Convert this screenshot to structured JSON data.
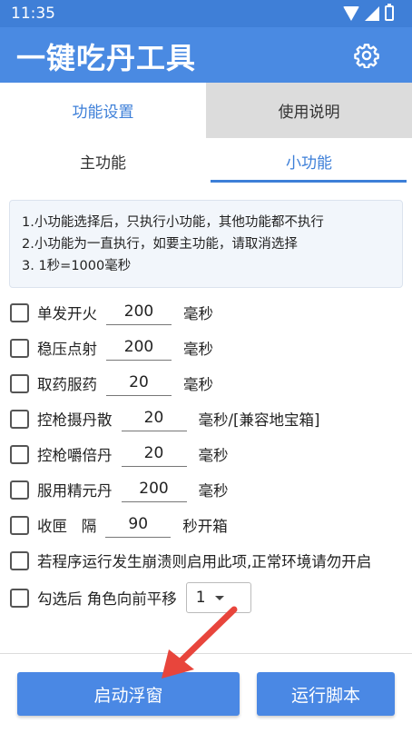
{
  "status_bar": {
    "time": "11:35"
  },
  "app": {
    "title": "一键吃丹工具",
    "settings_icon": "gear-icon"
  },
  "top_tabs": [
    {
      "label": "功能设置",
      "active": true
    },
    {
      "label": "使用说明",
      "active": false
    }
  ],
  "sub_tabs": [
    {
      "label": "主功能",
      "active": false
    },
    {
      "label": "小功能",
      "active": true
    }
  ],
  "info": {
    "lines": [
      "1.小功能选择后，只执行小功能，其他功能都不执行",
      "2.小功能为一直执行，如要主功能，请取消选择",
      "3. 1秒=1000毫秒"
    ]
  },
  "options": [
    {
      "label": "单发开火",
      "value": "200",
      "unit": "毫秒",
      "checked": false
    },
    {
      "label": "稳压点射",
      "value": "200",
      "unit": "毫秒",
      "checked": false
    },
    {
      "label": "取药服药",
      "value": "20",
      "unit": "毫秒",
      "checked": false
    },
    {
      "label": "控枪摄丹散",
      "value": "20",
      "unit": "毫秒/[兼容地宝箱]",
      "checked": false
    },
    {
      "label": "控枪嚼倍丹",
      "value": "20",
      "unit": "毫秒",
      "checked": false
    },
    {
      "label": "服用精元丹",
      "value": "200",
      "unit": "毫秒",
      "checked": false
    },
    {
      "label": "收匣   隔",
      "value": "90",
      "unit": "秒开箱",
      "checked": false
    },
    {
      "label": "若程序运行发生崩溃则启用此项,正常环境请勿开启",
      "checked": false
    },
    {
      "label": "勾选后 角色向前平移",
      "select_value": "1",
      "checked": false
    }
  ],
  "buttons": {
    "float": "启动浮窗",
    "run": "运行脚本"
  },
  "colors": {
    "primary": "#4a8ae2",
    "accent": "#3d7fd8",
    "arrow": "#e8453c"
  }
}
